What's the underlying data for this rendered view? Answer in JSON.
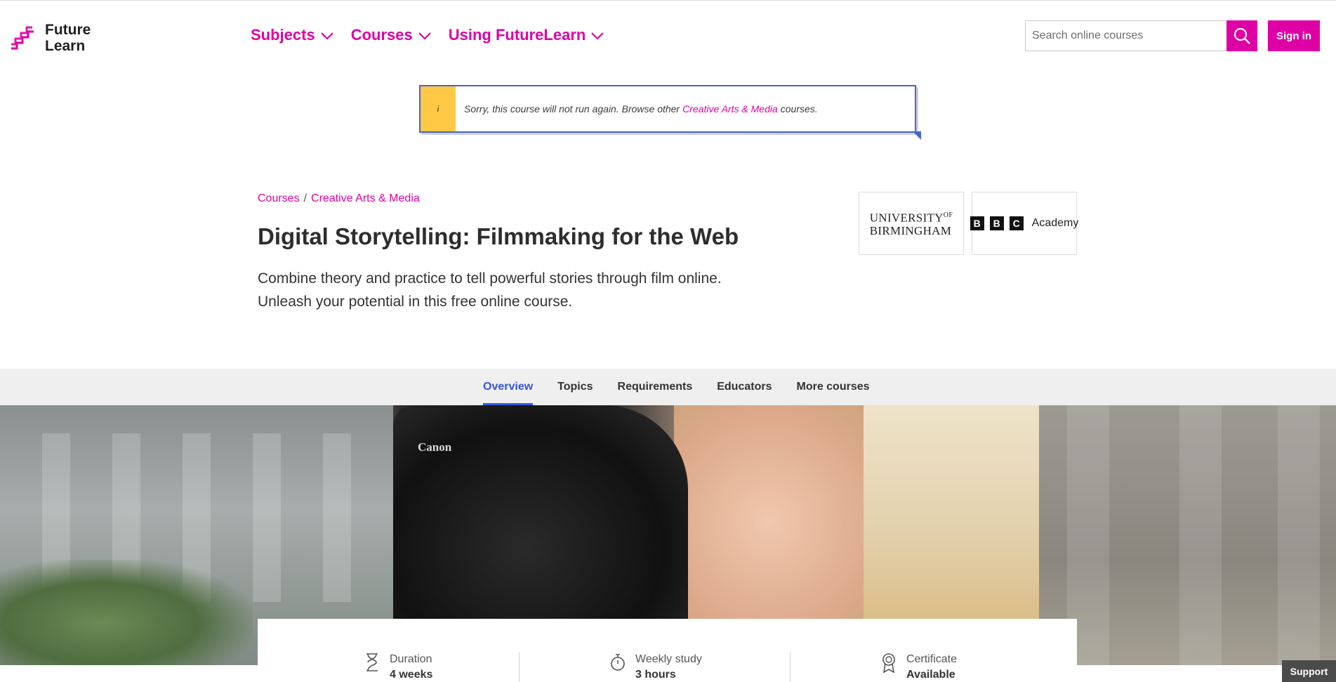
{
  "header": {
    "logo": {
      "line1": "Future",
      "line2": "Learn"
    },
    "nav": [
      {
        "label": "Subjects"
      },
      {
        "label": "Courses"
      },
      {
        "label": "Using FutureLearn"
      }
    ],
    "search": {
      "placeholder": "Search online courses",
      "icon": "search-icon"
    },
    "signin_label": "Sign in"
  },
  "notice": {
    "icon_text": "i",
    "text_before": "Sorry, this course will not run again. Browse other",
    "link": "Creative Arts & Media",
    "text_after": "courses."
  },
  "course": {
    "breadcrumb": [
      "Courses",
      "Creative Arts & Media"
    ],
    "breadcrumb_sep": "/",
    "title": "Digital Storytelling: Filmmaking for the Web",
    "description_line1": "Combine theory and practice to tell powerful stories through film online.",
    "description_line2": "Unleash your potential in this free online course."
  },
  "partners": {
    "uob_line1": "UNIVERSITY",
    "uob_of": "OF",
    "uob_line2": "BIRMINGHAM",
    "bbc_letters": [
      "B",
      "B",
      "C"
    ],
    "bbc_academy": "Academy"
  },
  "tabs": [
    {
      "label": "Overview",
      "active": true
    },
    {
      "label": "Topics",
      "active": false
    },
    {
      "label": "Requirements",
      "active": false
    },
    {
      "label": "Educators",
      "active": false
    },
    {
      "label": "More courses",
      "active": false
    }
  ],
  "photo": {
    "camera_brand": "Canon"
  },
  "info": [
    {
      "label": "Duration",
      "value": "4 weeks",
      "icon": "hourglass-icon"
    },
    {
      "label": "Weekly study",
      "value": "3 hours",
      "icon": "stopwatch-icon"
    },
    {
      "label": "Certificate",
      "value": "Available",
      "icon": "award-icon"
    }
  ],
  "support_label": "Support",
  "colors": {
    "brand": "#de00a5",
    "notice_accent": "#ffc845",
    "notice_border": "#4466cc",
    "tab_active": "#3355dd"
  }
}
